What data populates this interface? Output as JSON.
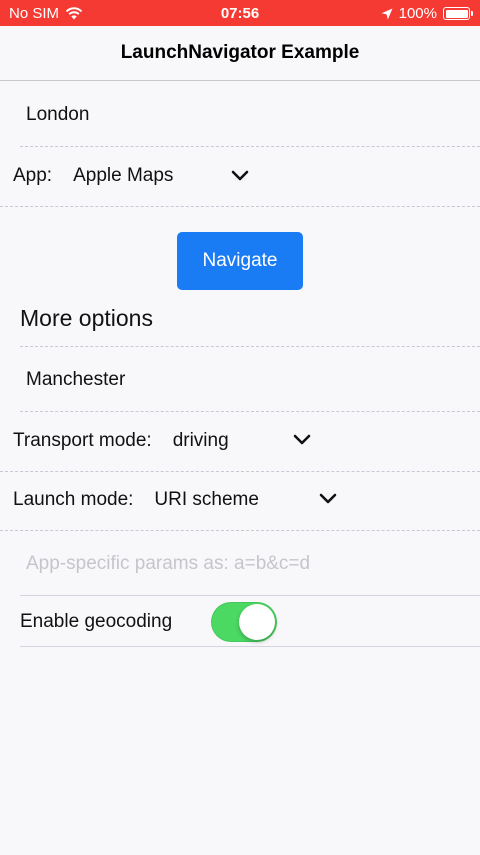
{
  "status_bar": {
    "carrier": "No SIM",
    "time": "07:56",
    "battery": "100%",
    "color": "#f43a32"
  },
  "nav": {
    "title": "LaunchNavigator Example"
  },
  "destination": {
    "value": "London"
  },
  "app_select": {
    "label": "App:",
    "value": "Apple Maps"
  },
  "navigate_button": {
    "label": "Navigate",
    "color": "#1a7cf5"
  },
  "more_options": {
    "title": "More options",
    "start": {
      "value": "Manchester"
    },
    "transport_mode": {
      "label": "Transport mode:",
      "value": "driving"
    },
    "launch_mode": {
      "label": "Launch mode:",
      "value": "URI scheme"
    },
    "extras": {
      "placeholder": "App-specific params as: a=b&c=d"
    },
    "geocoding": {
      "label": "Enable geocoding",
      "enabled": true,
      "color": "#4bd863"
    }
  }
}
